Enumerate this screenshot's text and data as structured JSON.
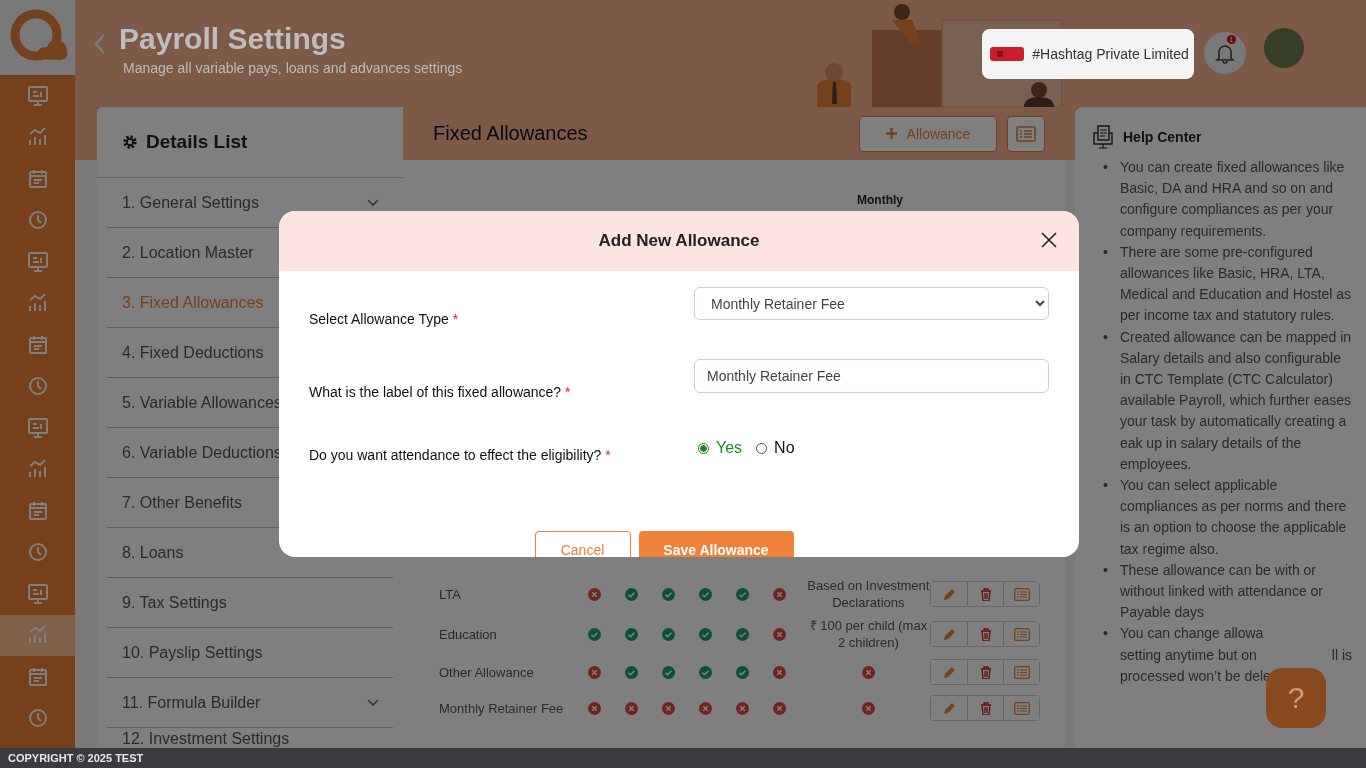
{
  "sidebar": {
    "items": [
      {
        "selected": false
      },
      {
        "selected": false
      },
      {
        "selected": false
      },
      {
        "selected": false
      },
      {
        "selected": false
      },
      {
        "selected": false
      },
      {
        "selected": false
      },
      {
        "selected": false
      },
      {
        "selected": false
      },
      {
        "selected": false
      },
      {
        "selected": false
      },
      {
        "selected": false
      },
      {
        "selected": false
      },
      {
        "selected": true
      },
      {
        "selected": false
      },
      {
        "selected": false
      }
    ]
  },
  "header": {
    "title": "Payroll Settings",
    "subtitle": "Manage all variable pays, loans and advances settings",
    "company": "#Hashtag Private Limited",
    "notification_count": "1"
  },
  "details_list": {
    "title": "Details List",
    "items": [
      {
        "label": "1. General Settings",
        "selected": false,
        "expandable": true
      },
      {
        "label": "2. Location Master",
        "selected": false
      },
      {
        "label": "3. Fixed Allowances",
        "selected": true
      },
      {
        "label": "4. Fixed Deductions",
        "selected": false
      },
      {
        "label": "5. Variable Allowances",
        "selected": false
      },
      {
        "label": "6. Variable Deductions",
        "selected": false
      },
      {
        "label": "7. Other Benefits",
        "selected": false
      },
      {
        "label": "8. Loans",
        "selected": false,
        "expandable": false
      },
      {
        "label": "9. Tax Settings",
        "selected": false,
        "expandable": false
      },
      {
        "label": "10. Payslip Settings",
        "selected": false,
        "expandable": false
      },
      {
        "label": "11. Formula Builder",
        "selected": false,
        "expandable": true
      },
      {
        "label": "12. Investment Settings",
        "selected": false,
        "expandable": false
      }
    ]
  },
  "main": {
    "title": "Fixed Allowances",
    "add_button": "Allowance",
    "table": {
      "columns": [
        "Monthly"
      ],
      "rows": [
        {
          "name": "LTA",
          "checks": [
            false,
            true,
            true,
            true,
            true,
            false
          ],
          "monthly": {
            "kind": "text",
            "text": "Based on Investment Declarations"
          }
        },
        {
          "name": "Education",
          "checks": [
            true,
            true,
            true,
            true,
            true,
            false
          ],
          "monthly": {
            "kind": "text",
            "text": "₹  100 per child (max 2 children)"
          }
        },
        {
          "name": "Other Allowance",
          "checks": [
            false,
            true,
            true,
            true,
            true,
            false
          ],
          "monthly": {
            "kind": "cross"
          }
        },
        {
          "name": "Monthly Retainer Fee",
          "checks": [
            false,
            false,
            false,
            false,
            false,
            false
          ],
          "monthly": {
            "kind": "cross"
          }
        }
      ]
    }
  },
  "help": {
    "title": "Help Center",
    "items": [
      {
        "kind": "full",
        "bullet": "•",
        "text": "You can create fixed allowances like Basic, DA and HRA and so on and configure compliances as per your company requirements."
      },
      {
        "kind": "full",
        "bullet": "•",
        "text": "There are some pre-configured allowances like Basic, HRA, LTA, Medical and Education and Hostel as per income tax and statutory rules."
      },
      {
        "kind": "full",
        "bullet": "•",
        "text": "Created allowance can be mapped in Salary details and also configurable in CTC Template (CTC Calculator) available Payroll, which further eases your task by automatically creating a\neak up in salary details of the employees."
      },
      {
        "kind": "full",
        "bullet": "•",
        "text": "You can select applicable compliances as per norms and there is an option to choose the applicable tax regime also."
      },
      {
        "kind": "full",
        "bullet": "•",
        "text": "These allowance can be with or without linked with attendance or Payable days"
      },
      {
        "kind": "partial",
        "bullet": "•",
        "lines": [
          {
            "left": "You can change allowa"
          },
          {
            "left": "setting anytime but on",
            "right": "ll is"
          },
          {
            "left": "processed won’t be dele"
          }
        ]
      }
    ],
    "help_button": "?"
  },
  "modal": {
    "title": "Add New Allowance",
    "fields": [
      {
        "kind": "select",
        "label": "Select Allowance Type",
        "required_mark": "*",
        "value": "Monthly Retainer Fee"
      },
      {
        "kind": "input",
        "label": "What is the label of this fixed allowance?",
        "required_mark": "*",
        "value": "Monthly Retainer Fee"
      },
      {
        "kind": "radio",
        "label": "Do you want attendance to effect the eligibility?",
        "required_mark": "*",
        "options": [
          {
            "label": "Yes",
            "selected": true
          },
          {
            "label": "No",
            "selected": false
          }
        ]
      }
    ],
    "cancel": "Cancel",
    "save": "Save Allowance"
  },
  "footer": "COPYRIGHT © 2025 TEST"
}
